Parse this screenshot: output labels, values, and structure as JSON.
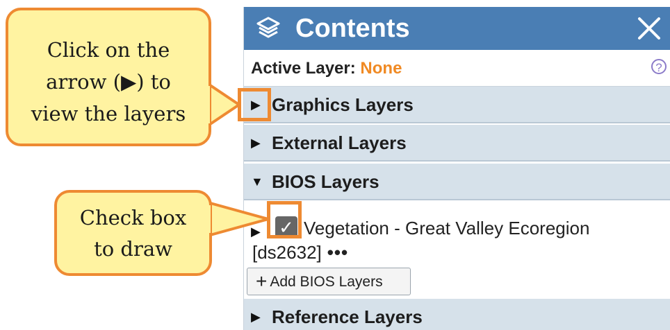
{
  "panel": {
    "title": "Contents",
    "icons": {
      "layers": "layers-stack-icon",
      "close": "close-x-icon",
      "help": "help-circle-icon"
    },
    "active_layer_label": "Active Layer:",
    "active_layer_value": "None",
    "help_glyph": "?",
    "groups": [
      {
        "arrow": "▶",
        "name": "Graphics Layers",
        "expanded": false
      },
      {
        "arrow": "▶",
        "name": "External Layers",
        "expanded": false
      },
      {
        "arrow": "▼",
        "name": "BIOS Layers",
        "expanded": true
      },
      {
        "arrow": "▶",
        "name": "Reference Layers",
        "expanded": false
      }
    ],
    "bios_layer": {
      "arrow": "▶",
      "checked": true,
      "check_glyph": "✓",
      "name_line1": "Vegetation - Great Valley Ecoregion",
      "name_line2": "[ds2632]",
      "more": "•••"
    },
    "add_button": {
      "icon": "+",
      "label": "Add BIOS Layers"
    }
  },
  "callouts": {
    "arrow_hint": [
      "Click on the",
      "arrow (▶) to",
      "view the layers"
    ],
    "checkbox_hint": [
      "Check box",
      "to draw"
    ]
  },
  "colors": {
    "header_bg": "#4a7eb4",
    "group_bg": "#d6e1ea",
    "accent_orange": "#ee8a32",
    "active_value": "#f08a24",
    "callout_bg": "#fff3a1"
  }
}
